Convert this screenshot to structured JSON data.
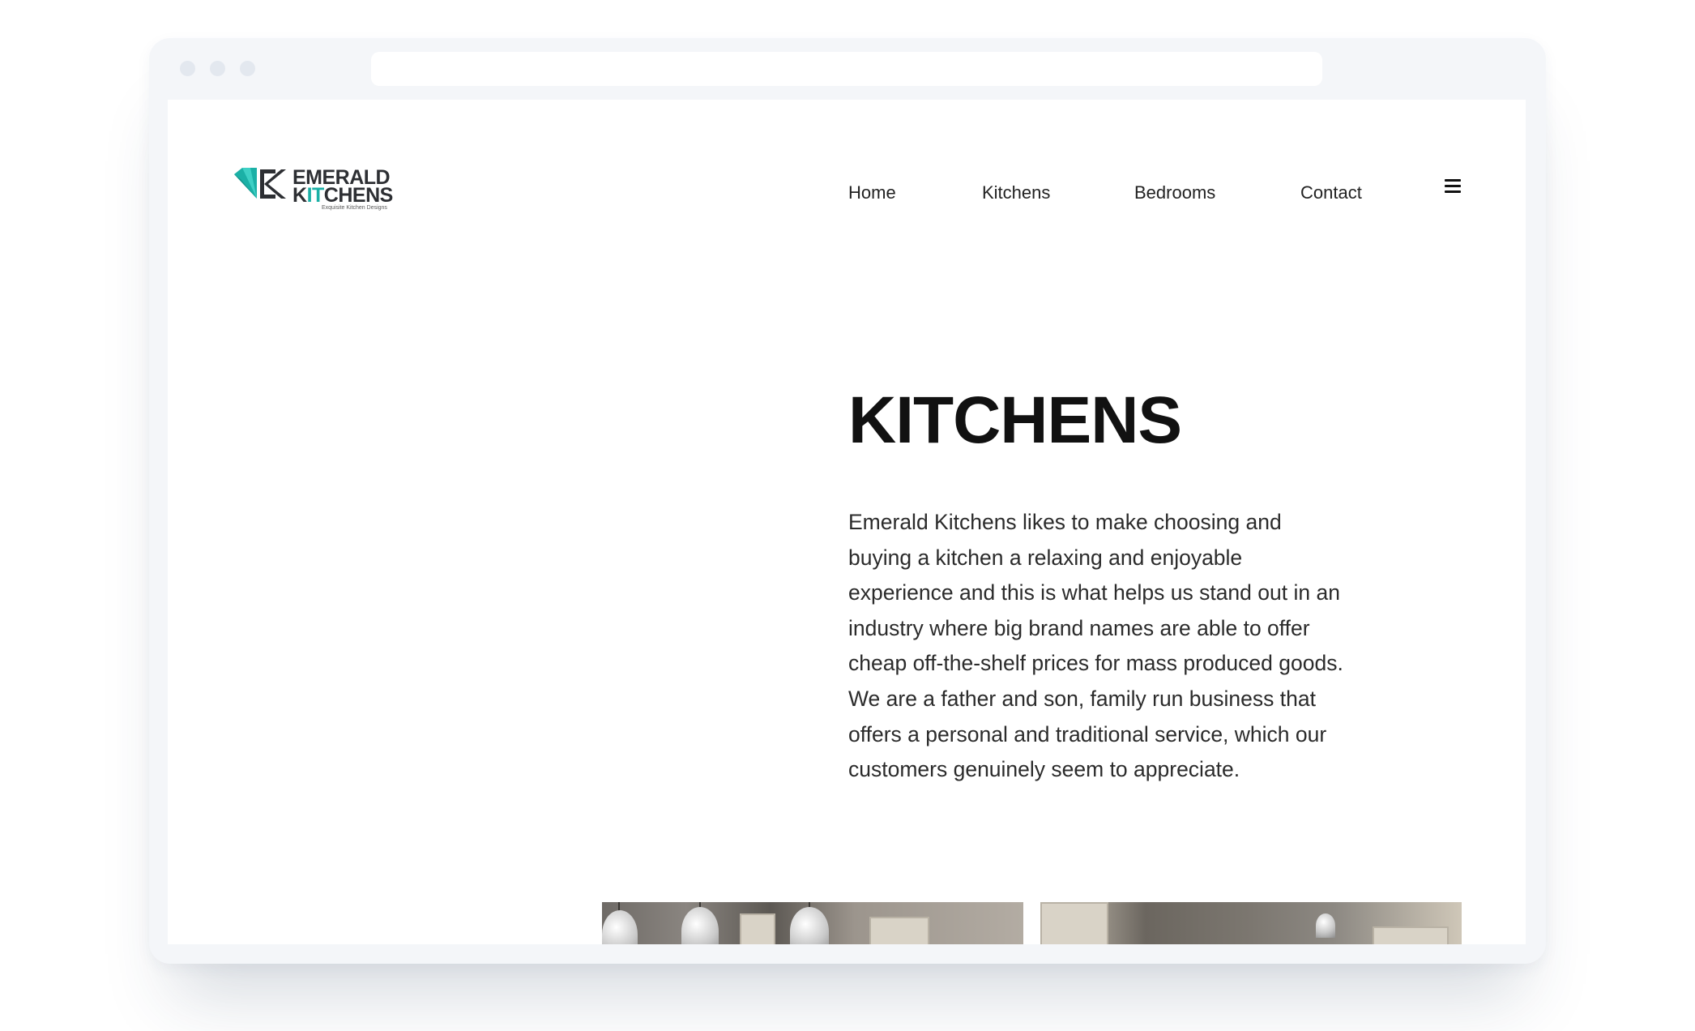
{
  "site": {
    "logo": {
      "line1": "EMERALD",
      "line2_a": "K",
      "line2_b": "IT",
      "line2_c": "CHENS",
      "tagline": "Exquisite Kitchen Designs"
    },
    "nav": [
      {
        "label": "Home"
      },
      {
        "label": "Kitchens"
      },
      {
        "label": "Bedrooms"
      },
      {
        "label": "Contact"
      }
    ],
    "menu_icon": "hamburger-icon"
  },
  "hero": {
    "heading": "KITCHENS",
    "body": "Emerald Kitchens likes to make choosing and buying a kitchen a relaxing and enjoyable experience and this is what helps us stand out in an industry where big brand names are able to offer cheap off-the-shelf prices for mass produced goods. We are a father and son, family run business that offers a personal and traditional service, which our customers genuinely seem to appreciate."
  },
  "colors": {
    "brand_teal": "#1bb0a6",
    "brand_dark": "#2d2f33",
    "frame": "#f4f6f9"
  }
}
